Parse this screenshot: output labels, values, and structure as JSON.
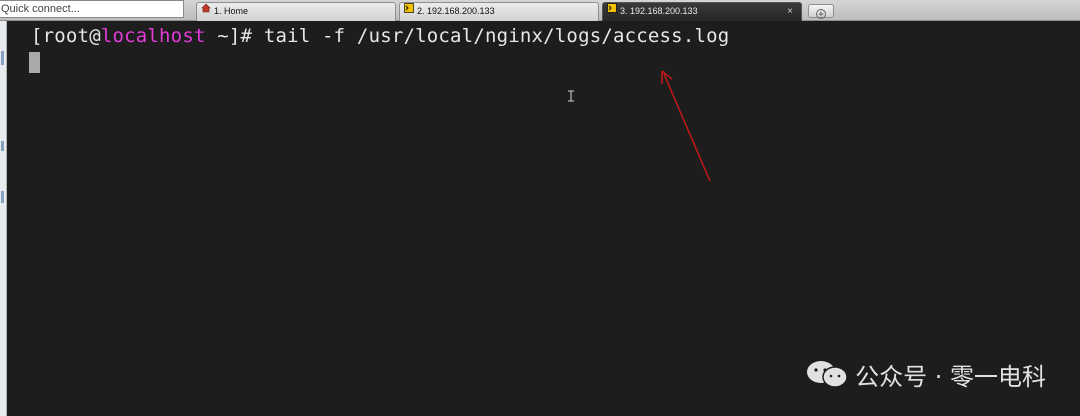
{
  "toolbar": {
    "quick_connect_placeholder": "Quick connect..."
  },
  "tabs": [
    {
      "label": "1. Home",
      "icon": "home-icon",
      "active": false
    },
    {
      "label": "2. 192.168.200.133",
      "icon": "terminal-icon",
      "active": false
    },
    {
      "label": "3. 192.168.200.133",
      "icon": "terminal-icon",
      "active": true,
      "close": "×"
    }
  ],
  "terminal": {
    "prompt_open": "[root@",
    "prompt_host": "localhost",
    "prompt_close": " ~]# ",
    "command": "tail -f /usr/local/nginx/logs/access.log"
  },
  "watermark": {
    "text": "公众号 · 零一电科"
  },
  "colors": {
    "terminal_bg": "#1d1d1d",
    "terminal_fg": "#e6e6e6",
    "host_color": "#e23bd9",
    "annotation_arrow": "#d01818"
  }
}
